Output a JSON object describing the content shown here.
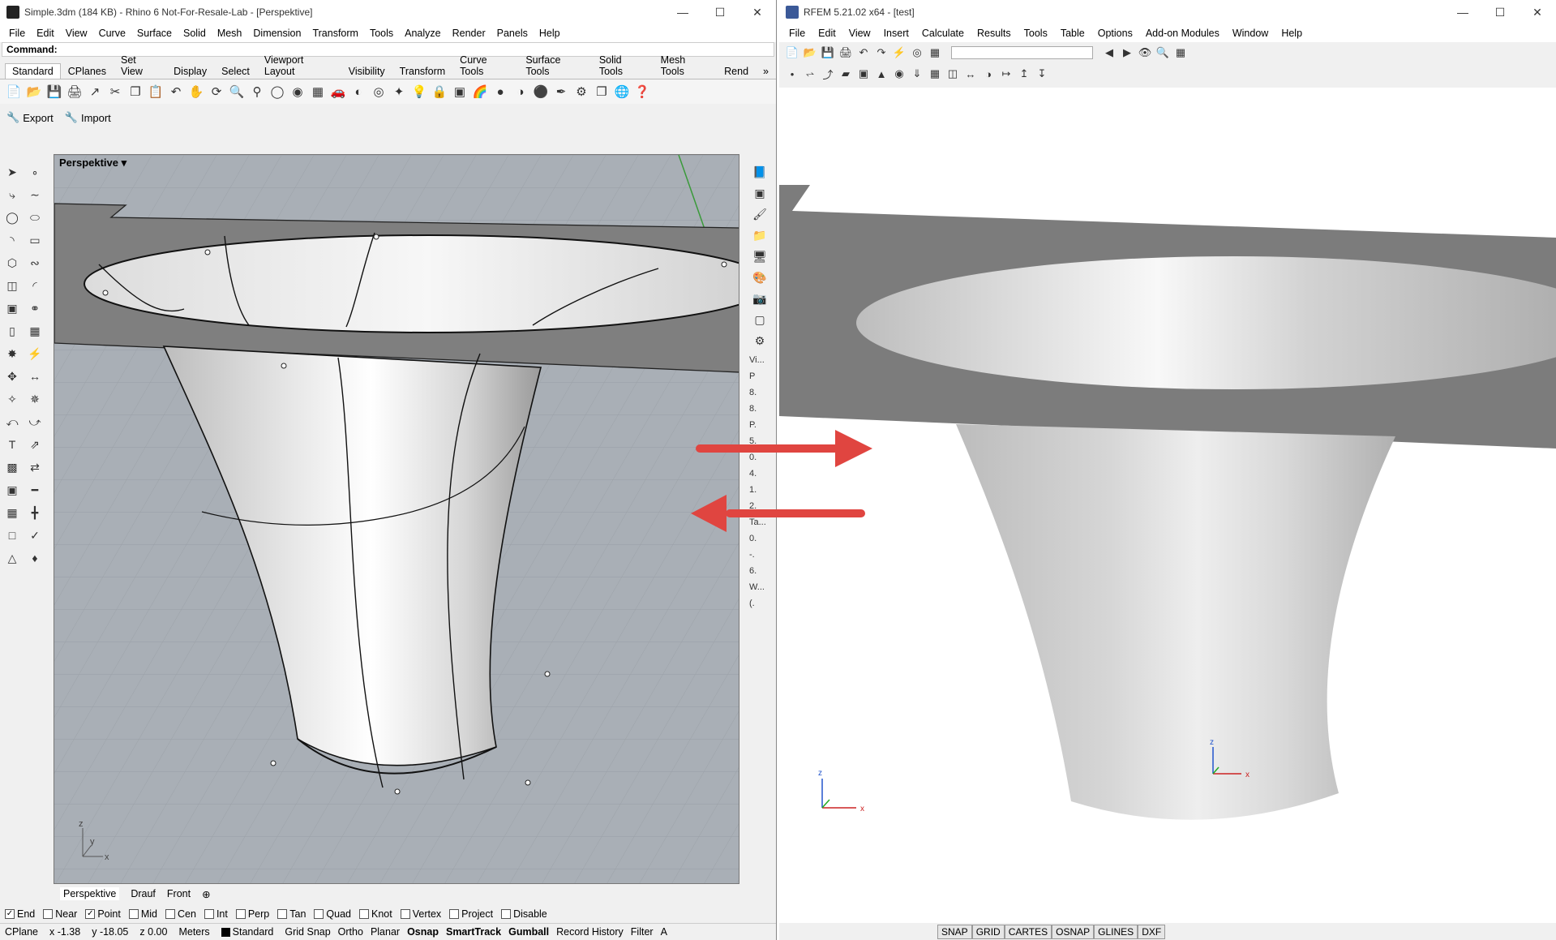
{
  "rhino": {
    "title": "Simple.3dm (184 KB) - Rhino 6 Not-For-Resale-Lab - [Perspektive]",
    "menu": [
      "File",
      "Edit",
      "View",
      "Curve",
      "Surface",
      "Solid",
      "Mesh",
      "Dimension",
      "Transform",
      "Tools",
      "Analyze",
      "Render",
      "Panels",
      "Help"
    ],
    "command_label": "Command:",
    "tabs": [
      "Standard",
      "CPlanes",
      "Set View",
      "Display",
      "Select",
      "Viewport Layout",
      "Visibility",
      "Transform",
      "Curve Tools",
      "Surface Tools",
      "Solid Tools",
      "Mesh Tools",
      "Rend"
    ],
    "export_label": "Export",
    "import_label": "Import",
    "viewport_name": "Perspektive",
    "viewport_tabs": [
      "Perspektive",
      "Drauf",
      "Front"
    ],
    "osnaps": [
      {
        "label": "End",
        "checked": true
      },
      {
        "label": "Near",
        "checked": false
      },
      {
        "label": "Point",
        "checked": true
      },
      {
        "label": "Mid",
        "checked": false
      },
      {
        "label": "Cen",
        "checked": false
      },
      {
        "label": "Int",
        "checked": false
      },
      {
        "label": "Perp",
        "checked": false
      },
      {
        "label": "Tan",
        "checked": false
      },
      {
        "label": "Quad",
        "checked": false
      },
      {
        "label": "Knot",
        "checked": false
      },
      {
        "label": "Vertex",
        "checked": false
      },
      {
        "label": "Project",
        "checked": false
      },
      {
        "label": "Disable",
        "checked": false
      }
    ],
    "status": {
      "cplane": "CPlane",
      "x": "x -1.38",
      "y": "y -18.05",
      "z": "z 0.00",
      "units": "Meters",
      "layer": "Standard",
      "toggles": [
        "Grid Snap",
        "Ortho",
        "Planar",
        "Osnap",
        "SmartTrack",
        "Gumball",
        "Record History",
        "Filter",
        "A"
      ]
    },
    "panel_texts": [
      "Vi...",
      "P",
      "8.",
      "8.",
      "P.",
      "5.",
      "0.",
      "4.",
      "1.",
      "2.",
      "Ta...",
      "0.",
      "-.",
      "6.",
      "W...",
      "(."
    ]
  },
  "rfem": {
    "title": "RFEM 5.21.02 x64 - [test]",
    "menu": [
      "File",
      "Edit",
      "View",
      "Insert",
      "Calculate",
      "Results",
      "Tools",
      "Table",
      "Options",
      "Add-on Modules",
      "Window",
      "Help"
    ],
    "status_toggles": [
      "SNAP",
      "GRID",
      "CARTES",
      "OSNAP",
      "GLINES",
      "DXF"
    ]
  },
  "colors": {
    "arrow": "#e04540",
    "rhino_viewport_bg": "#a9afb6",
    "rfem_plate": "#7c7c7c"
  }
}
